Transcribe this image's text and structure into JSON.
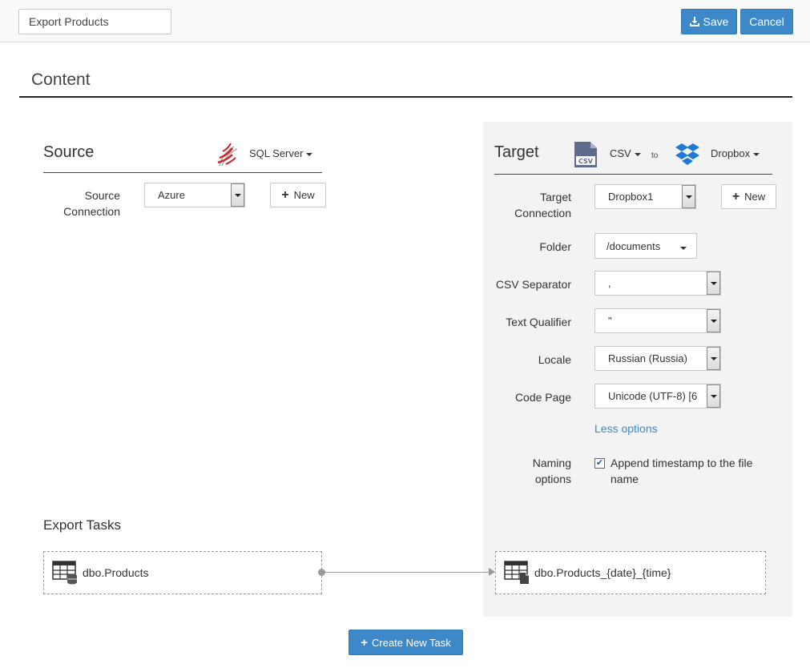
{
  "header": {
    "title_value": "Export Products",
    "save_label": "Save",
    "cancel_label": "Cancel"
  },
  "content": {
    "title": "Content"
  },
  "source": {
    "title": "Source",
    "type": "SQL Server",
    "connection_label_1": "Source",
    "connection_label_2": "Connection",
    "connection_value": "Azure",
    "new_label": "New"
  },
  "target": {
    "title": "Target",
    "format": "CSV",
    "to_label": "to",
    "destination": "Dropbox",
    "connection_label_1": "Target",
    "connection_label_2": "Connection",
    "connection_value": "Dropbox1",
    "new_label": "New",
    "folder_label": "Folder",
    "folder_value": "/documents",
    "separator_label": "CSV Separator",
    "separator_value": ",",
    "qualifier_label": "Text Qualifier",
    "qualifier_value": "\"",
    "locale_label": "Locale",
    "locale_value": "Russian (Russia)",
    "codepage_label": "Code Page",
    "codepage_value": "Unicode (UTF-8) [6",
    "less_options": "Less options",
    "naming_label_1": "Naming",
    "naming_label_2": "options",
    "timestamp_label_1": "Append timestamp to the file",
    "timestamp_label_2": "name",
    "timestamp_checked": true
  },
  "tasks": {
    "title": "Export Tasks",
    "source_table": "dbo.Products",
    "target_file": "dbo.Products_{date}_{time}",
    "create_label": "Create New Task"
  },
  "colors": {
    "primary": "#3d88c8",
    "sql_server_red": "#c8282a",
    "dropbox_blue": "#1f7ad6",
    "csv_icon": "#5f6b8a"
  }
}
